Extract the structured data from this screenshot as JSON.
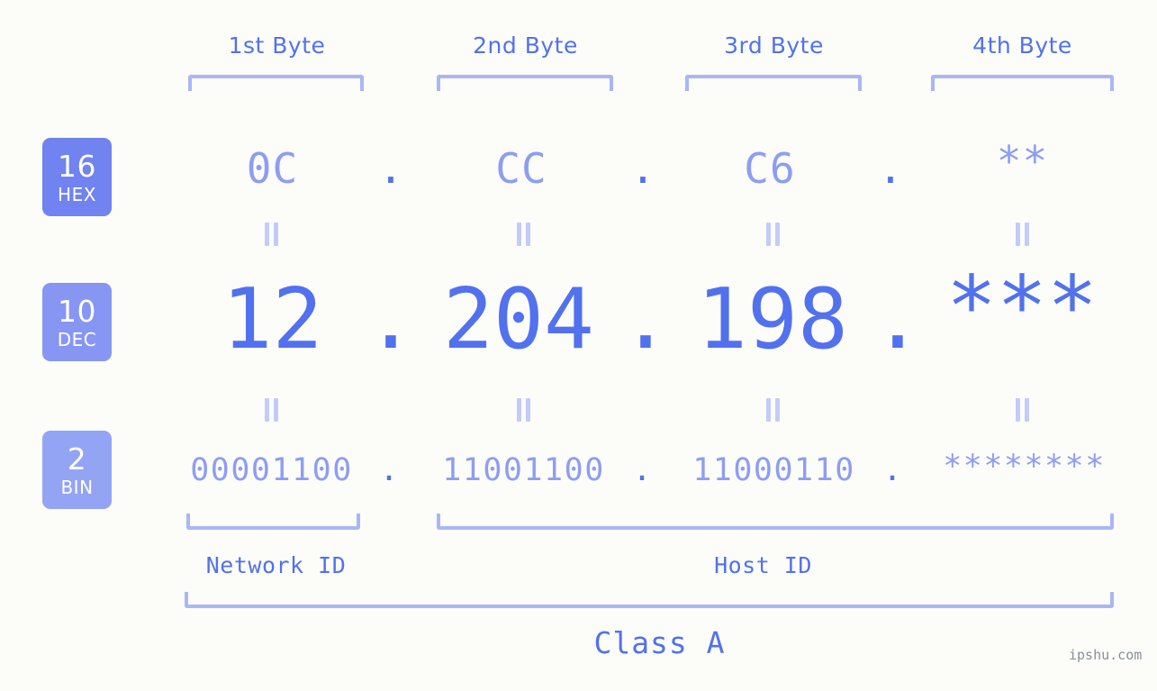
{
  "meta": {
    "background_color": "#fcfdf9",
    "accent_color": "#5271ee",
    "accent_light_color": "#8e9df3",
    "bracket_color": "#aab6f6",
    "watermark": "ipshu.com"
  },
  "byte_headers": [
    {
      "label": "1st Byte"
    },
    {
      "label": "2nd Byte"
    },
    {
      "label": "3rd Byte"
    },
    {
      "label": "4th Byte"
    }
  ],
  "bases": [
    {
      "number": "16",
      "name": "HEX",
      "color": "#7083f0"
    },
    {
      "number": "10",
      "name": "DEC",
      "color": "#8796f3"
    },
    {
      "number": "2",
      "name": "BIN",
      "color": "#93a4f5"
    }
  ],
  "rows": {
    "hex": {
      "base_number": "16",
      "base_name": "HEX",
      "bytes": [
        "0C",
        "CC",
        "C6",
        "**"
      ],
      "separator": "."
    },
    "dec": {
      "base_number": "10",
      "base_name": "DEC",
      "bytes": [
        "12",
        "204",
        "198",
        "***"
      ],
      "separator": "."
    },
    "bin": {
      "base_number": "2",
      "base_name": "BIN",
      "bytes": [
        "00001100",
        "11001100",
        "11000110",
        "********"
      ],
      "separator": "."
    }
  },
  "connectors": {
    "symbol": "="
  },
  "id_sections": [
    {
      "label": "Network ID"
    },
    {
      "label": "Host ID"
    }
  ],
  "class": {
    "label": "Class A"
  }
}
